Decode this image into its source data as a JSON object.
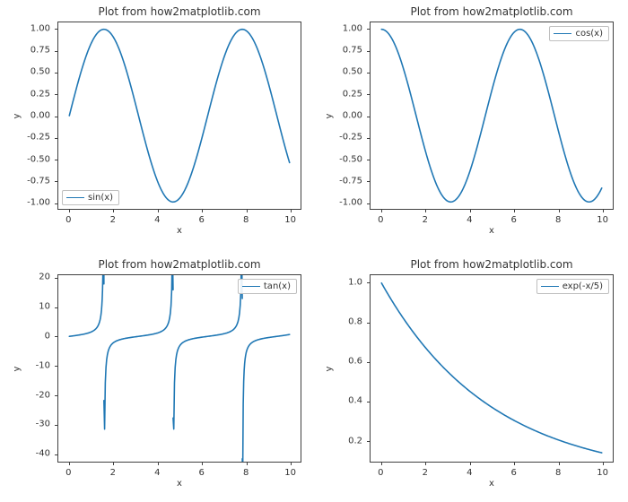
{
  "chart_data": [
    {
      "type": "line",
      "title": "Plot from how2matplotlib.com",
      "xlabel": "x",
      "ylabel": "y",
      "legend": "sin(x)",
      "legend_loc": "lower-left",
      "xlim": [
        -0.5,
        10.5
      ],
      "ylim": [
        -1.08,
        1.08
      ],
      "xticks": [
        0,
        2,
        4,
        6,
        8,
        10
      ],
      "yticks": [
        -1.0,
        -0.75,
        -0.5,
        -0.25,
        0.0,
        0.25,
        0.5,
        0.75,
        1.0
      ],
      "ytick_decimals": 2,
      "series": [
        {
          "name": "sin(x)",
          "fn": "sin"
        }
      ]
    },
    {
      "type": "line",
      "title": "Plot from how2matplotlib.com",
      "xlabel": "x",
      "ylabel": "y",
      "legend": "cos(x)",
      "legend_loc": "upper-right",
      "xlim": [
        -0.5,
        10.5
      ],
      "ylim": [
        -1.08,
        1.08
      ],
      "xticks": [
        0,
        2,
        4,
        6,
        8,
        10
      ],
      "yticks": [
        -1.0,
        -0.75,
        -0.5,
        -0.25,
        0.0,
        0.25,
        0.5,
        0.75,
        1.0
      ],
      "ytick_decimals": 2,
      "series": [
        {
          "name": "cos(x)",
          "fn": "cos"
        }
      ]
    },
    {
      "type": "line",
      "title": "Plot from how2matplotlib.com",
      "xlabel": "x",
      "ylabel": "y",
      "legend": "tan(x)",
      "legend_loc": "upper-right",
      "xlim": [
        -0.5,
        10.5
      ],
      "ylim": [
        -43,
        21
      ],
      "xticks": [
        0,
        2,
        4,
        6,
        8,
        10
      ],
      "yticks": [
        -40,
        -30,
        -20,
        -10,
        0,
        10,
        20
      ],
      "ytick_decimals": 0,
      "series": [
        {
          "name": "tan(x)",
          "fn": "tan"
        }
      ]
    },
    {
      "type": "line",
      "title": "Plot from how2matplotlib.com",
      "xlabel": "x",
      "ylabel": "y",
      "legend": "exp(-x/5)",
      "legend_loc": "upper-right",
      "xlim": [
        -0.5,
        10.5
      ],
      "ylim": [
        0.09,
        1.04
      ],
      "xticks": [
        0,
        2,
        4,
        6,
        8,
        10
      ],
      "yticks": [
        0.2,
        0.4,
        0.6,
        0.8,
        1.0
      ],
      "ytick_decimals": 1,
      "series": [
        {
          "name": "exp(-x/5)",
          "fn": "expneg"
        }
      ]
    }
  ]
}
